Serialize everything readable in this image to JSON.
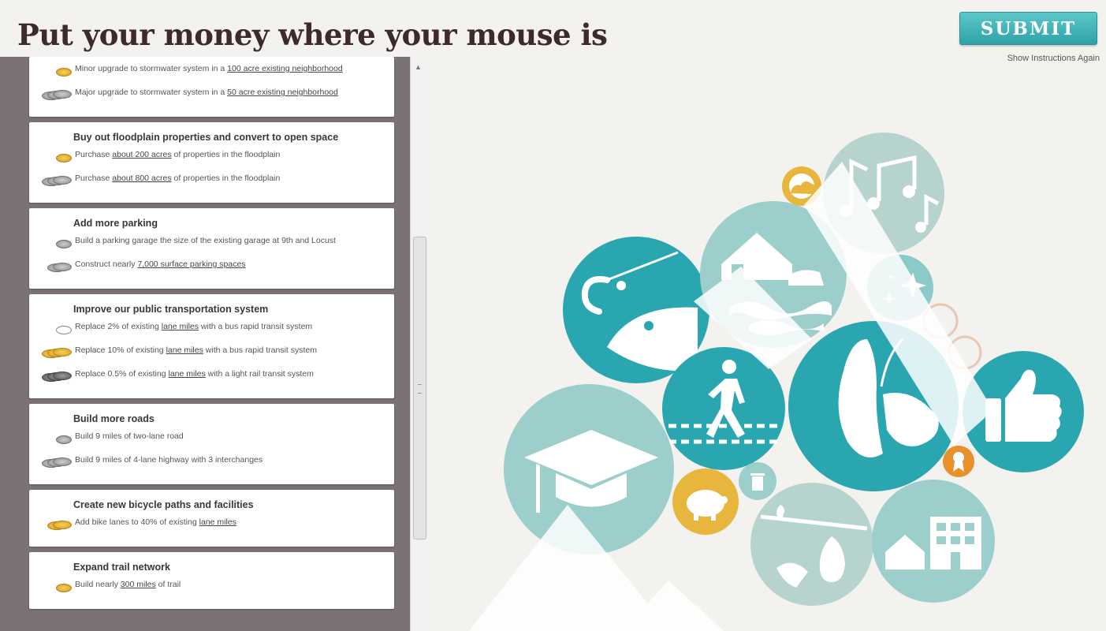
{
  "header": {
    "title": "Put your money where your mouse is",
    "submit_label": "SUBMIT",
    "instructions_label": "Show Instructions Again"
  },
  "colors": {
    "accent": "#2ea2a7",
    "teal_dark": "#2aa6b0",
    "teal_light": "#9ccfcb",
    "teal_pale": "#b7d3cd",
    "gold": "#e8b63c",
    "orange": "#e8902a"
  },
  "sidebar": {
    "cards": [
      {
        "title": "",
        "options": [
          {
            "coins": "gold1",
            "text_before": "Minor upgrade to stormwater system in a ",
            "link": "100 acre existing neighborhood",
            "text_after": ""
          },
          {
            "coins": "gray3",
            "text_before": "Major upgrade to stormwater system in a ",
            "link": "50 acre existing neighborhood",
            "text_after": ""
          }
        ]
      },
      {
        "title": "Buy out floodplain properties and convert to open space",
        "options": [
          {
            "coins": "gold1",
            "text_before": "Purchase ",
            "link": "about 200 acres",
            "text_after": " of properties in the floodplain"
          },
          {
            "coins": "gray3",
            "text_before": "Purchase ",
            "link": "about 800 acres",
            "text_after": " of properties in the floodplain"
          }
        ]
      },
      {
        "title": "Add more parking",
        "options": [
          {
            "coins": "gray1",
            "text_before": "Build a parking garage the size of the existing garage at 9th and Locust",
            "link": "",
            "text_after": ""
          },
          {
            "coins": "gray2",
            "text_before": "Construct nearly ",
            "link": "7,000 surface parking spaces",
            "text_after": ""
          }
        ]
      },
      {
        "title": "Improve our public transportation system",
        "options": [
          {
            "coins": "white1",
            "text_before": "Replace 2% of existing ",
            "link": "lane miles",
            "text_after": " with a bus rapid transit system"
          },
          {
            "coins": "gold3",
            "text_before": "Replace 10% of existing ",
            "link": "lane miles",
            "text_after": " with a bus rapid transit system"
          },
          {
            "coins": "dark3",
            "text_before": "Replace 0.5% of existing ",
            "link": "lane miles",
            "text_after": " with a light rail transit system"
          }
        ]
      },
      {
        "title": "Build more roads",
        "options": [
          {
            "coins": "gray1",
            "text_before": "Build 9 miles of two-lane road",
            "link": "",
            "text_after": ""
          },
          {
            "coins": "gray3",
            "text_before": "Build 9 miles of 4-lane highway with 3 interchanges",
            "link": "",
            "text_after": ""
          }
        ]
      },
      {
        "title": "Create new bicycle paths and facilities",
        "options": [
          {
            "coins": "gold2",
            "text_before": "Add bike lanes to 40% of existing ",
            "link": "lane miles",
            "text_after": ""
          }
        ]
      },
      {
        "title": "Expand trail network",
        "options": [
          {
            "coins": "gold1",
            "text_before": "Build nearly ",
            "link": "300 miles",
            "text_after": " of trail"
          }
        ]
      }
    ]
  },
  "bubbles": [
    {
      "name": "fishing-bubble",
      "icon": "fish-hook-icon",
      "tone": "teal_dark"
    },
    {
      "name": "flooding-bubble",
      "icon": "flooded-house-icon",
      "tone": "teal_light"
    },
    {
      "name": "music-bubble",
      "icon": "music-notes-icon",
      "tone": "teal_pale"
    },
    {
      "name": "sparkle-bubble",
      "icon": "sparkle-icon",
      "tone": "teal_light"
    },
    {
      "name": "walking-bubble",
      "icon": "pedestrian-icon",
      "tone": "teal_dark"
    },
    {
      "name": "butterfly-bubble",
      "icon": "butterfly-icon",
      "tone": "teal_dark"
    },
    {
      "name": "thumbs-up-bubble",
      "icon": "thumbs-up-icon",
      "tone": "teal_dark"
    },
    {
      "name": "education-bubble",
      "icon": "graduation-cap-icon",
      "tone": "teal_light"
    },
    {
      "name": "savings-bubble",
      "icon": "piggy-bank-icon",
      "tone": "gold"
    },
    {
      "name": "litter-bubble",
      "icon": "trash-can-icon",
      "tone": "teal_light"
    },
    {
      "name": "food-bubble",
      "icon": "pear-branch-icon",
      "tone": "teal_pale"
    },
    {
      "name": "housing-bubble",
      "icon": "buildings-icon",
      "tone": "teal_light"
    },
    {
      "name": "weather-bubble",
      "icon": "cloud-sun-icon",
      "tone": "gold"
    },
    {
      "name": "award-bubble",
      "icon": "ribbon-award-icon",
      "tone": "orange"
    }
  ]
}
